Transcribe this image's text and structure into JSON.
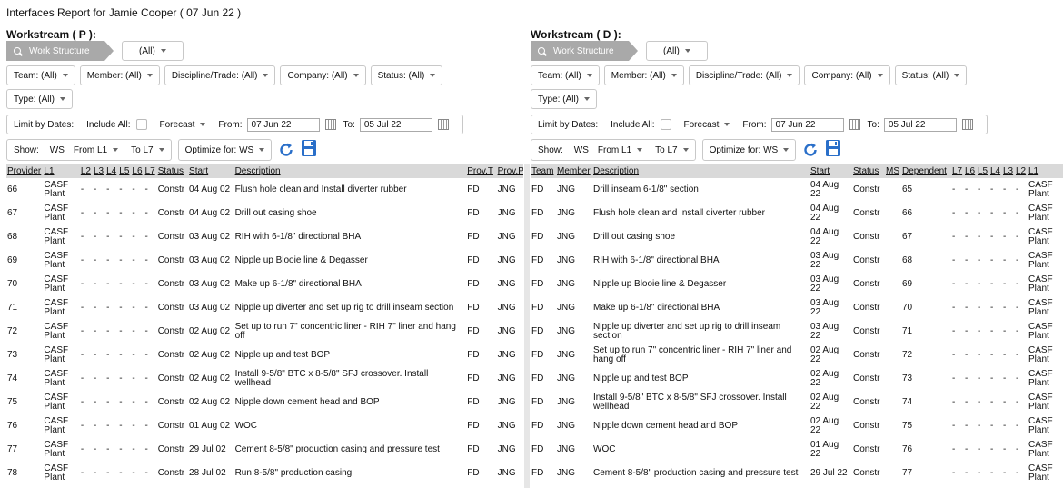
{
  "report_title": "Interfaces Report for Jamie Cooper ( 07 Jun 22 )",
  "panels": {
    "p": {
      "title": "Workstream ( P ):",
      "ws_structure_label": "Work Structure",
      "ws_value": "(All)",
      "filters": {
        "team": "Team: (All)",
        "member": "Member: (All)",
        "discipline": "Discipline/Trade: (All)",
        "company": "Company: (All)",
        "status": "Status: (All)",
        "type": "Type: (All)"
      },
      "limit_by_dates": "Limit by Dates:",
      "include_all": "Include All:",
      "forecast": "Forecast",
      "from_label": "From:",
      "from_value": "07 Jun 22",
      "to_label": "To:",
      "to_value": "05 Jul 22",
      "show_label": "Show:",
      "show_ws": "WS",
      "show_from": "From L1",
      "show_to": "To L7",
      "optimize": "Optimize for: WS",
      "columns": [
        "Provider",
        "L1",
        "L2",
        "L3",
        "L4",
        "L5",
        "L6",
        "L7",
        "Status",
        "Start",
        "Description",
        "Prov.T",
        "Prov.P"
      ],
      "rows": [
        [
          "66",
          "CASF Plant",
          "-",
          "-",
          "-",
          "-",
          "-",
          "-",
          "Constr",
          "04 Aug 02",
          "Flush hole clean and Install diverter rubber",
          "FD",
          "JNG"
        ],
        [
          "67",
          "CASF Plant",
          "-",
          "-",
          "-",
          "-",
          "-",
          "-",
          "Constr",
          "04 Aug 02",
          "Drill out casing shoe",
          "FD",
          "JNG"
        ],
        [
          "68",
          "CASF Plant",
          "-",
          "-",
          "-",
          "-",
          "-",
          "-",
          "Constr",
          "03 Aug 02",
          "RIH with 6-1/8\" directional BHA",
          "FD",
          "JNG"
        ],
        [
          "69",
          "CASF Plant",
          "-",
          "-",
          "-",
          "-",
          "-",
          "-",
          "Constr",
          "03 Aug 02",
          "Nipple up Blooie line & Degasser",
          "FD",
          "JNG"
        ],
        [
          "70",
          "CASF Plant",
          "-",
          "-",
          "-",
          "-",
          "-",
          "-",
          "Constr",
          "03 Aug 02",
          "Make up 6-1/8\" directional BHA",
          "FD",
          "JNG"
        ],
        [
          "71",
          "CASF Plant",
          "-",
          "-",
          "-",
          "-",
          "-",
          "-",
          "Constr",
          "03 Aug 02",
          "Nipple up diverter and set up rig to drill inseam section",
          "FD",
          "JNG"
        ],
        [
          "72",
          "CASF Plant",
          "-",
          "-",
          "-",
          "-",
          "-",
          "-",
          "Constr",
          "02 Aug 02",
          "Set up to run 7\" concentric liner - RIH 7\" liner and hang off",
          "FD",
          "JNG"
        ],
        [
          "73",
          "CASF Plant",
          "-",
          "-",
          "-",
          "-",
          "-",
          "-",
          "Constr",
          "02 Aug 02",
          "Nipple up and test BOP",
          "FD",
          "JNG"
        ],
        [
          "74",
          "CASF Plant",
          "-",
          "-",
          "-",
          "-",
          "-",
          "-",
          "Constr",
          "02 Aug 02",
          "Install 9-5/8\" BTC x 8-5/8\" SFJ crossover. Install wellhead",
          "FD",
          "JNG"
        ],
        [
          "75",
          "CASF Plant",
          "-",
          "-",
          "-",
          "-",
          "-",
          "-",
          "Constr",
          "02 Aug 02",
          "Nipple down cement head and BOP",
          "FD",
          "JNG"
        ],
        [
          "76",
          "CASF Plant",
          "-",
          "-",
          "-",
          "-",
          "-",
          "-",
          "Constr",
          "01 Aug 02",
          "WOC",
          "FD",
          "JNG"
        ],
        [
          "77",
          "CASF Plant",
          "-",
          "-",
          "-",
          "-",
          "-",
          "-",
          "Constr",
          "29 Jul 02",
          "Cement 8-5/8\" production casing and pressure test",
          "FD",
          "JNG"
        ],
        [
          "78",
          "CASF Plant",
          "-",
          "-",
          "-",
          "-",
          "-",
          "-",
          "Constr",
          "28 Jul 02",
          "Run 8-5/8\" production casing",
          "FD",
          "JNG"
        ]
      ]
    },
    "d": {
      "title": "Workstream ( D ):",
      "ws_structure_label": "Work Structure",
      "ws_value": "(All)",
      "filters": {
        "team": "Team: (All)",
        "member": "Member: (All)",
        "discipline": "Discipline/Trade: (All)",
        "company": "Company: (All)",
        "status": "Status: (All)",
        "type": "Type: (All)"
      },
      "limit_by_dates": "Limit by Dates:",
      "include_all": "Include All:",
      "forecast": "Forecast",
      "from_label": "From:",
      "from_value": "07 Jun 22",
      "to_label": "To:",
      "to_value": "05 Jul 22",
      "show_label": "Show:",
      "show_ws": "WS",
      "show_from": "From L1",
      "show_to": "To L7",
      "optimize": "Optimize for: WS",
      "columns": [
        "Team",
        "Member",
        "Description",
        "Start",
        "Status",
        "MS",
        "Dependent",
        "L7",
        "L6",
        "L5",
        "L4",
        "L3",
        "L2",
        "L1"
      ],
      "rows": [
        [
          "FD",
          "JNG",
          "Drill inseam 6-1/8\" section",
          "04 Aug 22",
          "Constr",
          "",
          "65",
          "-",
          "-",
          "-",
          "-",
          "-",
          "-",
          "CASF Plant"
        ],
        [
          "FD",
          "JNG",
          "Flush hole clean and Install diverter rubber",
          "04 Aug 22",
          "Constr",
          "",
          "66",
          "-",
          "-",
          "-",
          "-",
          "-",
          "-",
          "CASF Plant"
        ],
        [
          "FD",
          "JNG",
          "Drill out casing shoe",
          "04 Aug 22",
          "Constr",
          "",
          "67",
          "-",
          "-",
          "-",
          "-",
          "-",
          "-",
          "CASF Plant"
        ],
        [
          "FD",
          "JNG",
          "RIH with 6-1/8\" directional BHA",
          "03 Aug 22",
          "Constr",
          "",
          "68",
          "-",
          "-",
          "-",
          "-",
          "-",
          "-",
          "CASF Plant"
        ],
        [
          "FD",
          "JNG",
          "Nipple up Blooie line & Degasser",
          "03 Aug 22",
          "Constr",
          "",
          "69",
          "-",
          "-",
          "-",
          "-",
          "-",
          "-",
          "CASF Plant"
        ],
        [
          "FD",
          "JNG",
          "Make up 6-1/8\" directional BHA",
          "03 Aug 22",
          "Constr",
          "",
          "70",
          "-",
          "-",
          "-",
          "-",
          "-",
          "-",
          "CASF Plant"
        ],
        [
          "FD",
          "JNG",
          "Nipple up diverter and set up rig to drill inseam section",
          "03 Aug 22",
          "Constr",
          "",
          "71",
          "-",
          "-",
          "-",
          "-",
          "-",
          "-",
          "CASF Plant"
        ],
        [
          "FD",
          "JNG",
          "Set up to run 7\" concentric liner - RIH 7\" liner and hang off",
          "02 Aug 22",
          "Constr",
          "",
          "72",
          "-",
          "-",
          "-",
          "-",
          "-",
          "-",
          "CASF Plant"
        ],
        [
          "FD",
          "JNG",
          "Nipple up and test BOP",
          "02 Aug 22",
          "Constr",
          "",
          "73",
          "-",
          "-",
          "-",
          "-",
          "-",
          "-",
          "CASF Plant"
        ],
        [
          "FD",
          "JNG",
          "Install 9-5/8\" BTC x 8-5/8\" SFJ crossover. Install wellhead",
          "02 Aug 22",
          "Constr",
          "",
          "74",
          "-",
          "-",
          "-",
          "-",
          "-",
          "-",
          "CASF Plant"
        ],
        [
          "FD",
          "JNG",
          "Nipple down cement head and BOP",
          "02 Aug 22",
          "Constr",
          "",
          "75",
          "-",
          "-",
          "-",
          "-",
          "-",
          "-",
          "CASF Plant"
        ],
        [
          "FD",
          "JNG",
          "WOC",
          "01 Aug 22",
          "Constr",
          "",
          "76",
          "-",
          "-",
          "-",
          "-",
          "-",
          "-",
          "CASF Plant"
        ],
        [
          "FD",
          "JNG",
          "Cement 8-5/8\" production casing and pressure test",
          "29 Jul 22",
          "Constr",
          "",
          "77",
          "-",
          "-",
          "-",
          "-",
          "-",
          "-",
          "CASF Plant"
        ]
      ]
    }
  },
  "colors": {
    "ws_structure_bg": "#a9a9a9",
    "header_bg": "#d9d9d9",
    "icon_blue": "#2a6fc9"
  },
  "icons": [
    "search-icon",
    "caret-down-icon",
    "calendar-icon",
    "refresh-icon",
    "save-icon"
  ]
}
